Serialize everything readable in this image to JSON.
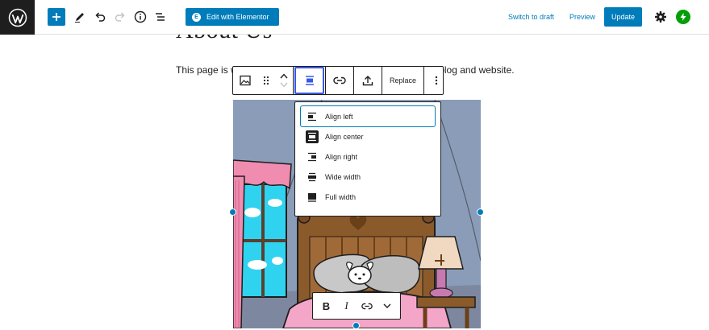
{
  "topbar": {
    "add_block_tooltip": "Add block",
    "elementor_badge": "E",
    "elementor_label": "Edit with Elementor",
    "switch_to_draft": "Switch to draft",
    "preview": "Preview",
    "update": "Update"
  },
  "content": {
    "title": "About Us",
    "paragraph": "This page is where all the information about the author of the blog and website."
  },
  "block_toolbar": {
    "replace_label": "Replace"
  },
  "alignment_menu": {
    "items": [
      {
        "label": "Align left",
        "icon": "align-left-icon"
      },
      {
        "label": "Align center",
        "icon": "align-center-icon"
      },
      {
        "label": "Align right",
        "icon": "align-right-icon"
      },
      {
        "label": "Wide width",
        "icon": "wide-width-icon"
      },
      {
        "label": "Full width",
        "icon": "full-width-icon"
      }
    ],
    "focused_item": "Align left",
    "active_item": "Align center"
  },
  "format_toolbar": {
    "bold": "B",
    "italic": "I"
  },
  "colors": {
    "accent": "#007cba",
    "focus": "#3858e9",
    "dark": "#1e1e1e",
    "jetpack": "#069e08"
  }
}
